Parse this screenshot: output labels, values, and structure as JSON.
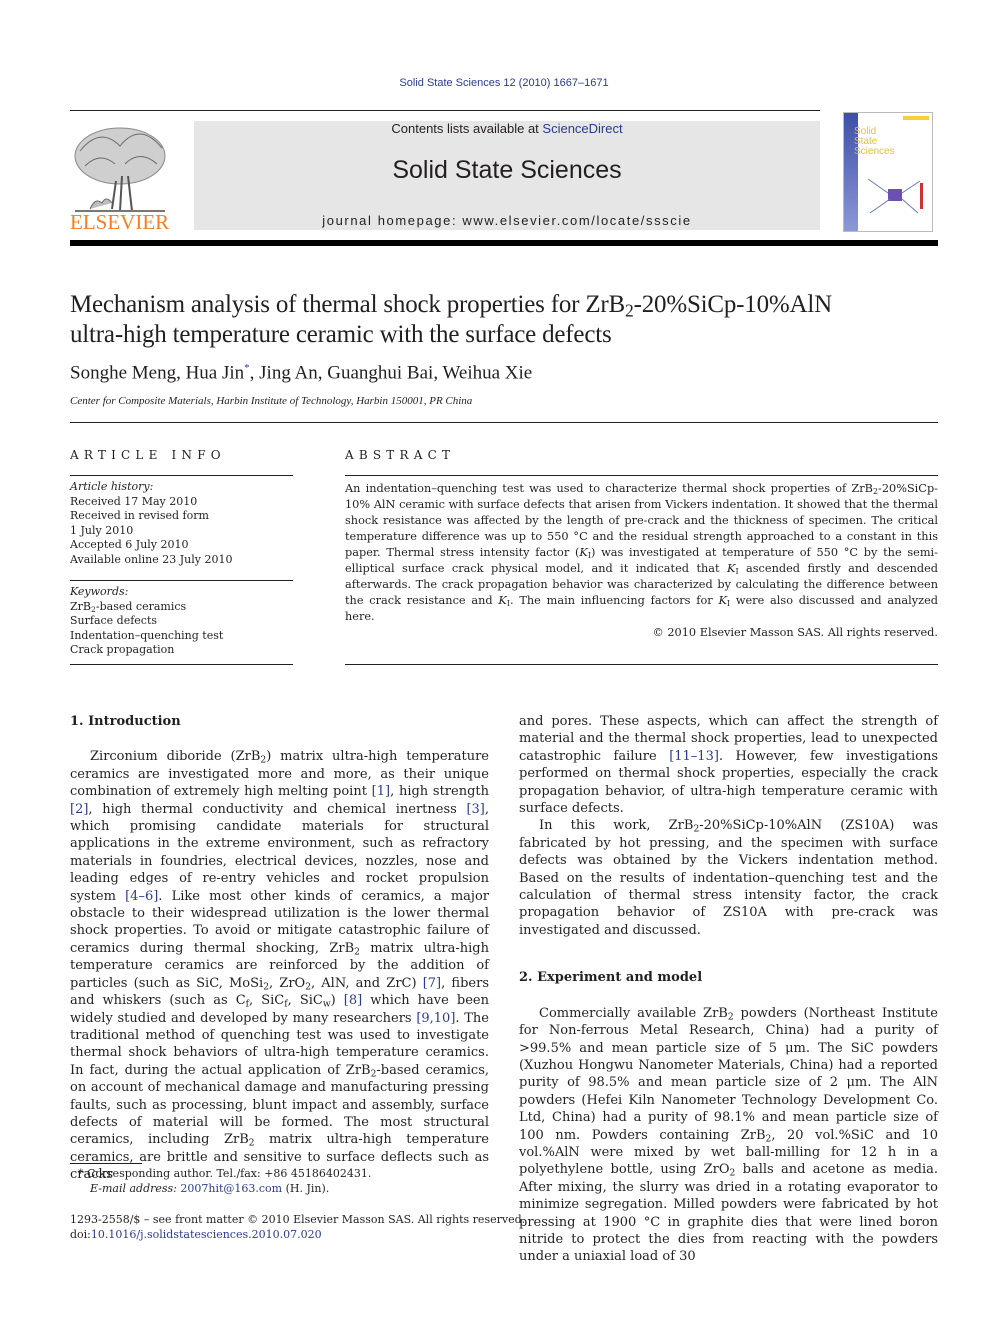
{
  "header": {
    "running_head": "Solid State Sciences 12 (2010) 1667–1671",
    "publisher_logo": "ELSEVIER",
    "contents_prefix": "Contents lists available at ",
    "contents_link": "ScienceDirect",
    "journal_name": "Solid State Sciences",
    "homepage": "journal homepage: www.elsevier.com/locate/ssscie",
    "cover_title_lines": [
      "Solid",
      "State",
      "Sciences"
    ]
  },
  "article": {
    "title_line1_pre": "Mechanism analysis of thermal shock properties for ZrB",
    "title_line1_sub": "2",
    "title_line1_post": "-20%SiCp-10%AlN",
    "title_line2": "ultra-high temperature ceramic with the surface defects",
    "authors_pre": "Songhe Meng, Hua Jin",
    "authors_mark": "*",
    "authors_post": ", Jing An, Guanghui Bai, Weihua Xie",
    "affiliation": "Center for Composite Materials, Harbin Institute of Technology, Harbin 150001, PR China"
  },
  "article_info": {
    "heading": "ARTICLE INFO",
    "history_label": "Article history:",
    "history": [
      "Received 17 May 2010",
      "Received in revised form",
      "1 July 2010",
      "Accepted 6 July 2010",
      "Available online 23 July 2010"
    ],
    "keywords_label": "Keywords:",
    "keyword1_pre": "ZrB",
    "keyword1_sub": "2",
    "keyword1_post": "-based ceramics",
    "keywords": [
      "Surface defects",
      "Indentation–quenching test",
      "Crack propagation"
    ]
  },
  "abstract": {
    "heading": "ABSTRACT",
    "p1": "An indentation–quenching test was used to characterize thermal shock properties of ZrB",
    "p1_sub": "2",
    "p2": "-20%SiCp-10% AlN ceramic with surface defects that arisen from Vickers indentation. It showed that the thermal shock resistance was affected by the length of pre-crack and the thickness of specimen. The critical temperature difference was up to 550 °C and the residual strength approached to a constant in this paper. Thermal stress intensity factor (",
    "k": "K",
    "k_sub": "I",
    "p3": ") was investigated at temperature of 550 °C by the semi-elliptical surface crack physical model, and it indicated that ",
    "p4": " ascended firstly and descended afterwards. The crack propagation behavior was characterized by calculating the difference between the crack resistance and ",
    "p5": ". The main influencing factors for ",
    "p6": " were also discussed and analyzed here.",
    "copyright": "© 2010 Elsevier Masson SAS. All rights reserved."
  },
  "intro": {
    "heading": "1.  Introduction",
    "t1": "Zirconium diboride (ZrB",
    "t2": ") matrix ultra-high temperature ceramics are investigated more and more, as their unique combination of extremely high melting point ",
    "c1": "[1]",
    "t3": ", high strength ",
    "c2": "[2]",
    "t4": ", high thermal conductivity and chemical inertness ",
    "c3": "[3]",
    "t5": ", which promising candidate materials for structural applications in the extreme environment, such as refractory materials in foundries, electrical devices, nozzles, nose and leading edges of re-entry vehicles and rocket propulsion system ",
    "c4": "[4–6]",
    "t6": ". Like most other kinds of ceramics, a major obstacle to their widespread utilization is the lower thermal shock properties. To avoid or mitigate catastrophic failure of ceramics during thermal shocking, ZrB",
    "t7": " matrix ultra-high temperature ceramics are reinforced by the addition of particles (such as SiC, MoSi",
    "t8": ", ZrO",
    "t9": ", AlN, and ZrC) ",
    "c5": "[7]",
    "t10": ", fibers and whiskers (such as C",
    "sub_f": "f",
    "t11": ", SiC",
    "t12": ", SiC",
    "sub_w": "w",
    "t13": ") ",
    "c6": "[8]",
    "t14": " which have been widely studied and developed by many researchers ",
    "c7": "[9,10]",
    "t15": ". The traditional method of quenching test was used to investigate thermal shock behaviors of ultra-high temperature ceramics. In fact, during the actual application of ZrB",
    "t16": "-based ceramics, on account of mechanical damage and manufacturing pressing faults, such as processing, blunt impact and assembly, surface defects of material will be formed. The most structural ceramics, including ZrB",
    "t17": " matrix ultra-high temperature ceramics, are brittle and sensitive to surface deflects such as cracks",
    "sub2": "2"
  },
  "col2": {
    "t1": "and pores. These aspects, which can affect the strength of material and the thermal shock properties, lead to unexpected catastrophic failure ",
    "c1": "[11–13]",
    "t2": ". However, few investigations performed on thermal shock properties, especially the crack propagation behavior, of ultra-high temperature ceramic with surface defects.",
    "p2a": "In this work, ZrB",
    "p2b": "-20%SiCp-10%AlN (ZS10A) was fabricated by hot pressing, and the specimen with surface defects was obtained by the Vickers indentation method. Based on the results of indentation–quenching test and the calculation of thermal stress intensity factor, the crack propagation behavior of ZS10A with pre-crack was investigated and discussed.",
    "heading": "2.  Experiment and model",
    "p3a": "Commercially available ZrB",
    "p3b": " powders (Northeast Institute for Non-ferrous Metal Research, China) had a purity of >99.5% and mean particle size of 5 μm. The SiC powders (Xuzhou Hongwu Nanometer Materials, China) had a reported purity of 98.5% and mean particle size of 2 μm. The AlN powders (Hefei Kiln Nanometer Technology Development Co. Ltd, China) had a purity of 98.1% and mean particle size of 100 nm. Powders containing ZrB",
    "p3c": ", 20 vol.%SiC and 10 vol.%AlN were mixed by wet ball-milling for 12 h in a polyethylene bottle, using ZrO",
    "p3d": " balls and acetone as media. After mixing, the slurry was dried in a rotating evaporator to minimize segregation. Milled powders were fabricated by hot pressing at 1900 °C in graphite dies that were lined boron nitride to protect the dies from reacting with the powders under a uniaxial load of 30",
    "sub2": "2"
  },
  "footnote": {
    "mark": "*",
    "corresponding": "Corresponding author. Tel./fax: +86 45186402431.",
    "email_label": "E-mail address: ",
    "email": "2007hit@163.com",
    "email_suffix": " (H. Jin).",
    "issn": "1293-2558/$ – see front matter © 2010 Elsevier Masson SAS. All rights reserved.",
    "doi_label": "doi:",
    "doi": "10.1016/j.solidstatesciences.2010.07.020"
  }
}
